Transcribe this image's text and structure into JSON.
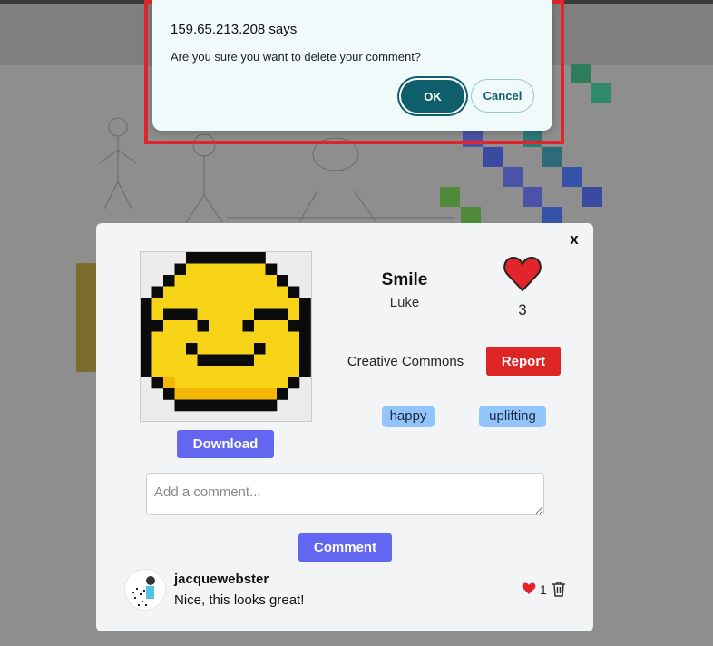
{
  "dialog": {
    "title": "159.65.213.208 says",
    "message": "Are you sure you want to delete your comment?",
    "ok_label": "OK",
    "cancel_label": "Cancel"
  },
  "artwork": {
    "title": "Smile",
    "author": "Luke",
    "like_count": "3",
    "license": "Creative Commons",
    "report_label": "Report",
    "download_label": "Download",
    "tags": [
      "happy",
      "uplifting"
    ]
  },
  "modal": {
    "close_label": "x",
    "comment_placeholder": "Add a comment...",
    "comment_button_label": "Comment"
  },
  "comments": [
    {
      "username": "jacquewebster",
      "text": "Nice, this looks great!",
      "likes": "1"
    }
  ],
  "colors": {
    "primary": "#6366f1",
    "danger": "#dc2626",
    "tag": "#93c5fd",
    "dialog_accent": "#0e5f6b",
    "highlight": "#e3242b"
  },
  "icons": [
    "heart-icon",
    "trash-icon",
    "close-icon"
  ]
}
